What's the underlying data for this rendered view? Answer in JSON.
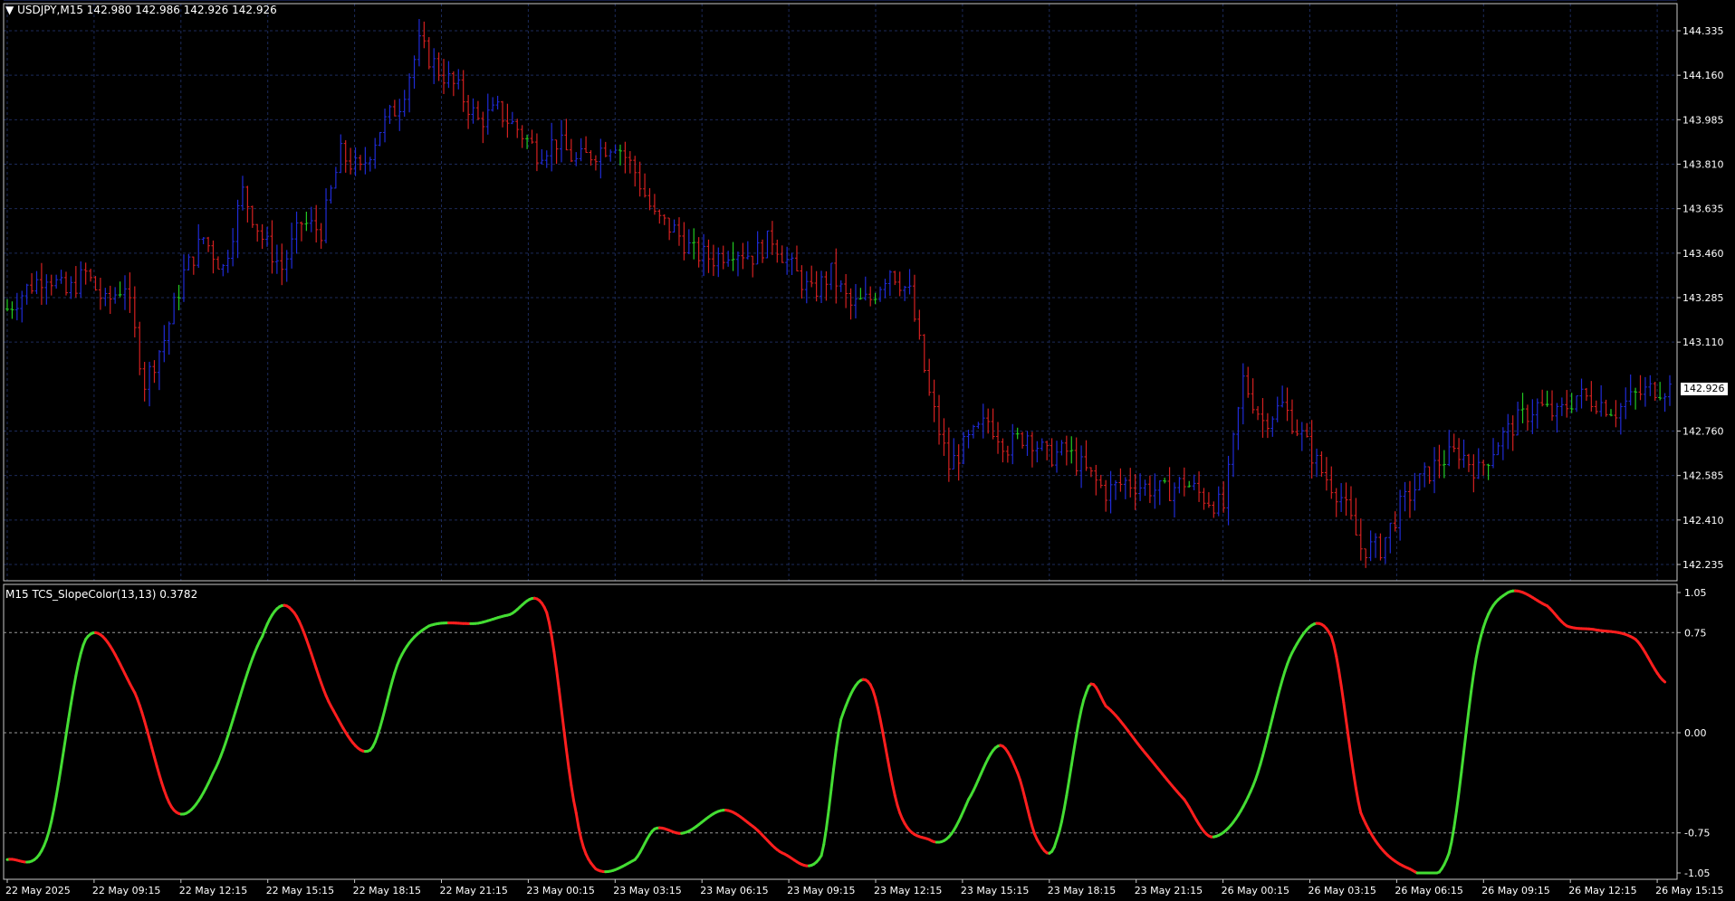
{
  "main_panel": {
    "symbol_header": "USDJPY,M15  142.980 142.986 142.926 142.926",
    "current_price_label": "142.926",
    "current_price": 142.926
  },
  "indicator_panel": {
    "header": "M15 TCS_SlopeColor(13,13) 0.3782"
  },
  "colors": {
    "background": "#000000",
    "grid": "#1c2a5a",
    "bull_bar": "#1f2bd6",
    "bear_bar": "#d42020",
    "doji_bar": "#22cc22",
    "up_slope": "#44dd33",
    "down_slope": "#ff1e1e",
    "axis_text": "#ffffff",
    "frame": "#c8c8c8"
  },
  "chart_data": [
    {
      "type": "ohlc",
      "title": "USDJPY,M15",
      "y_ticks": [
        "144.335",
        "144.160",
        "143.985",
        "143.810",
        "143.635",
        "143.460",
        "143.285",
        "143.110",
        "142.760",
        "142.585",
        "142.410",
        "142.235"
      ],
      "ylim": [
        142.2,
        144.4
      ],
      "x_ticks": [
        "22 May 2025",
        "22 May 09:15",
        "22 May 12:15",
        "22 May 15:15",
        "22 May 18:15",
        "22 May 21:15",
        "23 May 00:15",
        "23 May 03:15",
        "23 May 06:15",
        "23 May 09:15",
        "23 May 12:15",
        "23 May 15:15",
        "23 May 18:15",
        "23 May 21:15",
        "26 May 00:15",
        "26 May 03:15",
        "26 May 06:15",
        "26 May 09:15",
        "26 May 12:15",
        "26 May 15:15"
      ],
      "close_path": [
        [
          0,
          143.24
        ],
        [
          4,
          143.32
        ],
        [
          8,
          143.38
        ],
        [
          12,
          143.3
        ],
        [
          16,
          143.38
        ],
        [
          20,
          143.26
        ],
        [
          24,
          143.34
        ],
        [
          28,
          142.95
        ],
        [
          32,
          143.12
        ],
        [
          36,
          143.38
        ],
        [
          40,
          143.52
        ],
        [
          44,
          143.4
        ],
        [
          48,
          143.7
        ],
        [
          52,
          143.52
        ],
        [
          56,
          143.4
        ],
        [
          60,
          143.58
        ],
        [
          64,
          143.55
        ],
        [
          68,
          143.85
        ],
        [
          72,
          143.78
        ],
        [
          76,
          143.95
        ],
        [
          80,
          144.05
        ],
        [
          84,
          144.28
        ],
        [
          88,
          144.18
        ],
        [
          92,
          144.1
        ],
        [
          96,
          143.98
        ],
        [
          100,
          144.02
        ],
        [
          104,
          143.95
        ],
        [
          108,
          143.86
        ],
        [
          112,
          143.9
        ],
        [
          116,
          143.82
        ],
        [
          120,
          143.86
        ],
        [
          124,
          143.9
        ],
        [
          128,
          143.78
        ],
        [
          132,
          143.6
        ],
        [
          136,
          143.55
        ],
        [
          140,
          143.46
        ],
        [
          144,
          143.44
        ],
        [
          148,
          143.48
        ],
        [
          152,
          143.45
        ],
        [
          156,
          143.52
        ],
        [
          160,
          143.4
        ],
        [
          164,
          143.3
        ],
        [
          168,
          143.38
        ],
        [
          172,
          143.25
        ],
        [
          176,
          143.28
        ],
        [
          180,
          143.4
        ],
        [
          184,
          143.3
        ],
        [
          188,
          142.9
        ],
        [
          192,
          142.62
        ],
        [
          196,
          142.72
        ],
        [
          200,
          142.8
        ],
        [
          204,
          142.7
        ],
        [
          208,
          142.75
        ],
        [
          212,
          142.66
        ],
        [
          216,
          142.68
        ],
        [
          220,
          142.6
        ],
        [
          224,
          142.52
        ],
        [
          228,
          142.56
        ],
        [
          232,
          142.54
        ],
        [
          236,
          142.52
        ],
        [
          240,
          142.56
        ],
        [
          244,
          142.5
        ],
        [
          248,
          142.46
        ],
        [
          252,
          142.96
        ],
        [
          256,
          142.8
        ],
        [
          260,
          142.86
        ],
        [
          264,
          142.74
        ],
        [
          268,
          142.6
        ],
        [
          272,
          142.5
        ],
        [
          276,
          142.3
        ],
        [
          280,
          142.3
        ],
        [
          284,
          142.46
        ],
        [
          288,
          142.56
        ],
        [
          292,
          142.64
        ],
        [
          296,
          142.68
        ],
        [
          300,
          142.6
        ],
        [
          304,
          142.72
        ],
        [
          308,
          142.8
        ],
        [
          312,
          142.86
        ],
        [
          316,
          142.82
        ],
        [
          320,
          142.9
        ],
        [
          324,
          142.88
        ],
        [
          328,
          142.84
        ],
        [
          332,
          142.9
        ],
        [
          336,
          142.93
        ]
      ]
    },
    {
      "type": "line",
      "title": "TCS_SlopeColor(13,13)",
      "y_ticks": [
        "1.05",
        "0.75",
        "0.00",
        "-0.75",
        "-1.05"
      ],
      "ylim": [
        -1.05,
        1.05
      ],
      "levels": [
        0.75,
        0.0,
        -0.75
      ],
      "x": [
        0,
        8,
        16,
        26,
        34,
        42,
        52,
        58,
        66,
        74,
        80,
        86,
        96,
        102,
        110,
        116,
        120,
        128,
        132,
        138,
        146,
        152,
        158,
        166,
        170,
        176,
        182,
        188,
        192,
        196,
        202,
        206,
        210,
        214,
        220,
        224,
        232,
        240,
        246,
        254,
        262,
        270,
        276,
        286,
        294,
        300,
        306,
        314,
        318,
        324,
        332,
        338
      ],
      "values": [
        -0.95,
        -0.8,
        0.7,
        0.3,
        -0.58,
        -0.3,
        0.72,
        0.92,
        0.2,
        -0.13,
        0.55,
        0.8,
        0.82,
        0.88,
        0.9,
        -0.6,
        -1.02,
        -0.95,
        -0.72,
        -0.75,
        -0.58,
        -0.7,
        -0.9,
        -0.92,
        0.1,
        0.36,
        -0.6,
        -0.8,
        -0.78,
        -0.5,
        -0.1,
        -0.3,
        -0.8,
        -0.8,
        0.3,
        0.2,
        -0.15,
        -0.5,
        -0.78,
        -0.4,
        0.6,
        0.72,
        -0.6,
        -1.02,
        -0.9,
        0.65,
        1.05,
        0.95,
        0.8,
        0.77,
        0.7,
        0.38
      ],
      "slope_colors": "green when rising, red when falling"
    }
  ]
}
